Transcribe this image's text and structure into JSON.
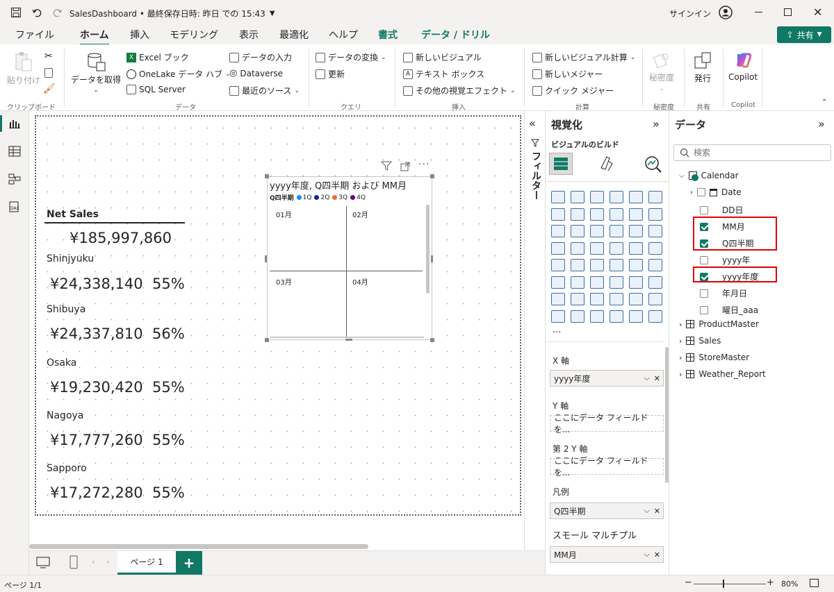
{
  "titlebar": {
    "title": "SalesDashboard • 最終保存日時: 昨日 での 15:43",
    "signin": "サインイン"
  },
  "tabs": [
    "ファイル",
    "ホーム",
    "挿入",
    "モデリング",
    "表示",
    "最適化",
    "ヘルプ",
    "書式",
    "データ / ドリル"
  ],
  "share": "共有",
  "ribbon": {
    "paste": "貼り付け",
    "get_data": "データを取得",
    "excel": "Excel ブック",
    "onelake": "OneLake データ ハブ",
    "sql": "SQL Server",
    "enter_data": "データの入力",
    "dataverse": "Dataverse",
    "recent": "最近のソース",
    "transform": "データの変換",
    "refresh": "更新",
    "new_visual": "新しいビジュアル",
    "textbox": "テキスト ボックス",
    "more_visuals": "その他の視覚エフェクト",
    "new_calc": "新しいビジュアル計算",
    "new_measure": "新しいメジャー",
    "quick_measure": "クイック メジャー",
    "sensitivity": "秘密度",
    "publish": "発行",
    "copilot": "Copilot",
    "groups": {
      "clipboard": "クリップボード",
      "data": "データ",
      "query": "クエリ",
      "insert": "挿入",
      "calc": "計算",
      "sensitivity": "秘密度",
      "share": "共有",
      "copilot": "Copilot"
    }
  },
  "cards": {
    "title": "Net Sales",
    "total": "¥185,997,860",
    "stores": [
      {
        "name": "Shinjyuku",
        "amount": "¥24,338,140",
        "pct": "55%"
      },
      {
        "name": "Shibuya",
        "amount": "¥24,337,810",
        "pct": "56%"
      },
      {
        "name": "Osaka",
        "amount": "¥19,230,420",
        "pct": "55%"
      },
      {
        "name": "Nagoya",
        "amount": "¥17,777,260",
        "pct": "55%"
      },
      {
        "name": "Sapporo",
        "amount": "¥17,272,280",
        "pct": "55%"
      }
    ]
  },
  "visual": {
    "title": "yyyy年度, Q四半期 および MM月",
    "legend_title": "Q四半期",
    "legend": [
      {
        "label": "1Q",
        "color": "#118dff"
      },
      {
        "label": "2Q",
        "color": "#12239e"
      },
      {
        "label": "3Q",
        "color": "#e66c37"
      },
      {
        "label": "4Q",
        "color": "#6b007b"
      }
    ],
    "cells": [
      "01月",
      "02月",
      "03月",
      "04月"
    ]
  },
  "filters_label": "フィルター",
  "viz": {
    "title": "視覚化",
    "build": "ビジュアルのビルド",
    "more": "...",
    "wells": [
      {
        "label": "X 軸",
        "value": "yyyy年度",
        "filled": true
      },
      {
        "label": "Y 軸",
        "value": "ここにデータ フィールドを...",
        "filled": false
      },
      {
        "label": "第 2 Y 軸",
        "value": "ここにデータ フィールドを...",
        "filled": false
      },
      {
        "label": "凡例",
        "value": "Q四半期",
        "filled": true
      },
      {
        "label": "スモール マルチプル",
        "value": "MM月",
        "filled": true
      }
    ]
  },
  "data_pane": {
    "title": "データ",
    "search_placeholder": "検索",
    "calendar": "Calendar",
    "fields": [
      {
        "name": "Date",
        "checked": false
      },
      {
        "name": "DD日",
        "checked": false
      },
      {
        "name": "MM月",
        "checked": true
      },
      {
        "name": "Q四半期",
        "checked": true
      },
      {
        "name": "yyyy年",
        "checked": false
      },
      {
        "name": "yyyy年度",
        "checked": true
      },
      {
        "name": "年月日",
        "checked": false
      },
      {
        "name": "曜日_aaa",
        "checked": false
      }
    ],
    "tables": [
      "ProductMaster",
      "Sales",
      "StoreMaster",
      "Weather_Report"
    ]
  },
  "pagebar": {
    "page_tab": "ページ 1",
    "add": "+"
  },
  "status": {
    "page": "ページ 1/1",
    "zoom": "80%"
  },
  "colors": {
    "accent": "#117865",
    "highlight": "#e00000"
  }
}
